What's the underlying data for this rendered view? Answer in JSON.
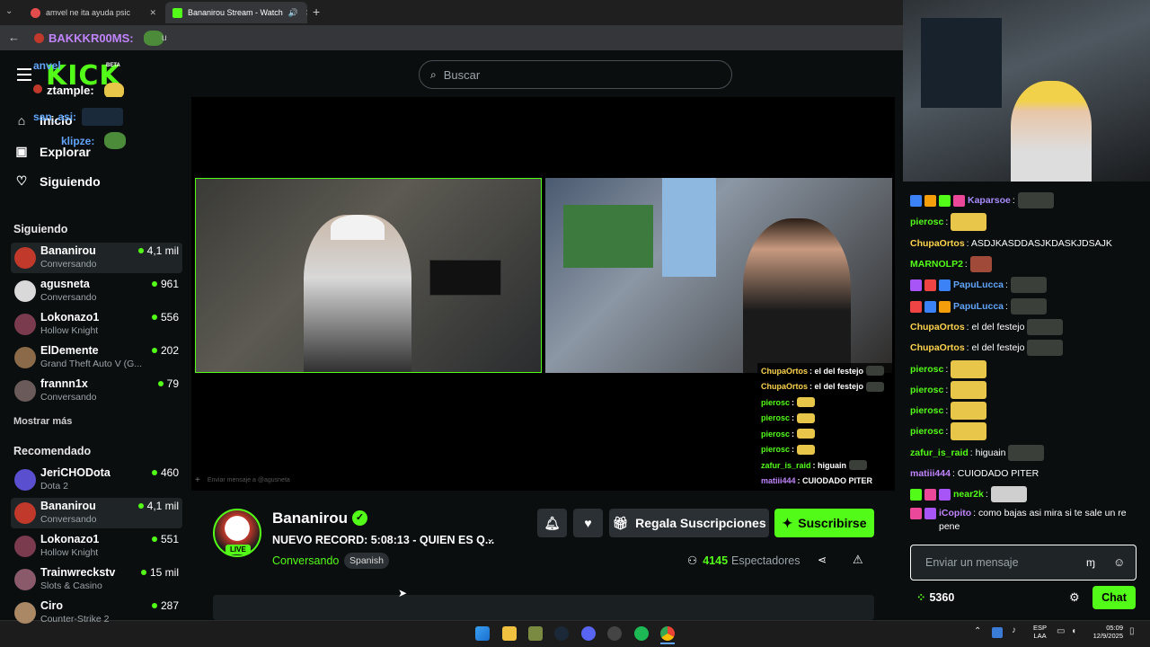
{
  "browser": {
    "tabs": [
      {
        "title": "amvel ne      ita ayuda psic"
      },
      {
        "title": "Bananirou Stream - Watch"
      }
    ],
    "new_tab": "+",
    "overlay_name": "BAKKKR00MS:",
    "overlay_suffix": "u"
  },
  "header": {
    "logo": "KICK",
    "logo_badge": "BETA",
    "search_placeholder": "Buscar",
    "menu_icon": "hamburger-icon"
  },
  "stream_overlay_names": {
    "a": "anvel",
    "b": "ztample:",
    "c": "san_asi:",
    "d": "klipze:"
  },
  "sidebar": {
    "nav": [
      {
        "label": "Inicio",
        "icon": "home-icon"
      },
      {
        "label": "Explorar",
        "icon": "compass-icon"
      },
      {
        "label": "Siguiendo",
        "icon": "heart-icon"
      }
    ],
    "following_title": "Siguiendo",
    "following": [
      {
        "name": "Bananirou",
        "game": "Conversando",
        "viewers": "4,1 mil",
        "color": "#c0392b"
      },
      {
        "name": "agusneta",
        "game": "Conversando",
        "viewers": "961",
        "color": "#d9d9d9"
      },
      {
        "name": "Lokonazo1",
        "game": "Hollow Knight",
        "viewers": "556",
        "color": "#7a3b4f"
      },
      {
        "name": "ElDemente",
        "game": "Grand Theft Auto V (G...",
        "viewers": "202",
        "color": "#8a6a48"
      },
      {
        "name": "frannn1x",
        "game": "Conversando",
        "viewers": "79",
        "color": "#6b5a5a"
      }
    ],
    "show_more": "Mostrar más",
    "recommended_title": "Recomendado",
    "recommended": [
      {
        "name": "JeriCHODota",
        "game": "Dota 2",
        "viewers": "460",
        "color": "#5a4fcf"
      },
      {
        "name": "Bananirou",
        "game": "Conversando",
        "viewers": "4,1 mil",
        "color": "#c0392b"
      },
      {
        "name": "Lokonazo1",
        "game": "Hollow Knight",
        "viewers": "551",
        "color": "#7a3b4f"
      },
      {
        "name": "Trainwreckstv",
        "game": "Slots & Casino",
        "viewers": "15 mil",
        "color": "#8a5a6a"
      },
      {
        "name": "Ciro",
        "game": "Counter-Strike 2",
        "viewers": "287",
        "color": "#aa8866"
      }
    ]
  },
  "player": {
    "stream_chat": [
      {
        "user": "ChupaOrtos",
        "text": ": el del festejo",
        "color": "#fcd34d"
      },
      {
        "user": "ChupaOrtos",
        "text": ": el del festejo",
        "color": "#fcd34d"
      },
      {
        "user": "pierosc",
        "text": ":",
        "color": "#53fc18"
      },
      {
        "user": "pierosc",
        "text": ":",
        "color": "#53fc18"
      },
      {
        "user": "pierosc",
        "text": ":",
        "color": "#53fc18"
      },
      {
        "user": "pierosc",
        "text": ":",
        "color": "#53fc18"
      },
      {
        "user": "zafur_is_raid",
        "text": ": higuain",
        "color": "#53fc18"
      },
      {
        "user": "matiii444",
        "text": ": CUIODADO PITER",
        "color": "#c084fc"
      }
    ],
    "chat_bar": "Enviar mensaje a @agusneta"
  },
  "channel": {
    "name": "Bananirou",
    "live_label": "LIVE",
    "title": "NUEVO RECORD: 5:08:13 - QUIEN ES Q...",
    "category": "Conversando",
    "tag": "Spanish",
    "gift_label": "Regala Suscripciones",
    "subscribe_label": "Suscribirse",
    "viewers": "4145",
    "viewers_label": "Espectadores"
  },
  "chat": {
    "messages": [
      {
        "user": "Kaparsoe",
        "text": ":",
        "color": "#a78bfa"
      },
      {
        "user": "pierosc",
        "text": ":",
        "color": "#53fc18"
      },
      {
        "user": "ChupaOrtos",
        "text": ": ASDJKASDDASJKDASKJDSAJK",
        "color": "#fcd34d"
      },
      {
        "user": "MARNOLP2",
        "text": ":",
        "color": "#53fc18"
      },
      {
        "user": "PapuLucca",
        "text": ":",
        "color": "#60a5fa"
      },
      {
        "user": "PapuLucca",
        "text": ":",
        "color": "#60a5fa"
      },
      {
        "user": "ChupaOrtos",
        "text": ": el del festejo",
        "color": "#fcd34d"
      },
      {
        "user": "ChupaOrtos",
        "text": ": el del festejo",
        "color": "#fcd34d"
      },
      {
        "user": "pierosc",
        "text": ":",
        "color": "#53fc18"
      },
      {
        "user": "pierosc",
        "text": ":",
        "color": "#53fc18"
      },
      {
        "user": "pierosc",
        "text": ":",
        "color": "#53fc18"
      },
      {
        "user": "pierosc",
        "text": ":",
        "color": "#53fc18"
      },
      {
        "user": "zafur_is_raid",
        "text": ": higuain",
        "color": "#53fc18"
      },
      {
        "user": "matiii444",
        "text": ": CUIODADO PITER",
        "color": "#c084fc"
      },
      {
        "user": "near2k",
        "text": ":",
        "color": "#53fc18"
      },
      {
        "user": "iCopito",
        "text": ": como bajas asi mira si te sale un re pene",
        "color": "#c084fc"
      }
    ],
    "input_placeholder": "Enviar un mensaje",
    "points": "5360",
    "chat_button": "Chat"
  },
  "taskbar": {
    "lang_top": "ESP",
    "lang_bottom": "LAA",
    "time": "05:09",
    "date": "12/9/2025"
  },
  "colors": {
    "accent": "#53fc18",
    "background": "#0b0e0f",
    "panel": "#1f2427"
  }
}
